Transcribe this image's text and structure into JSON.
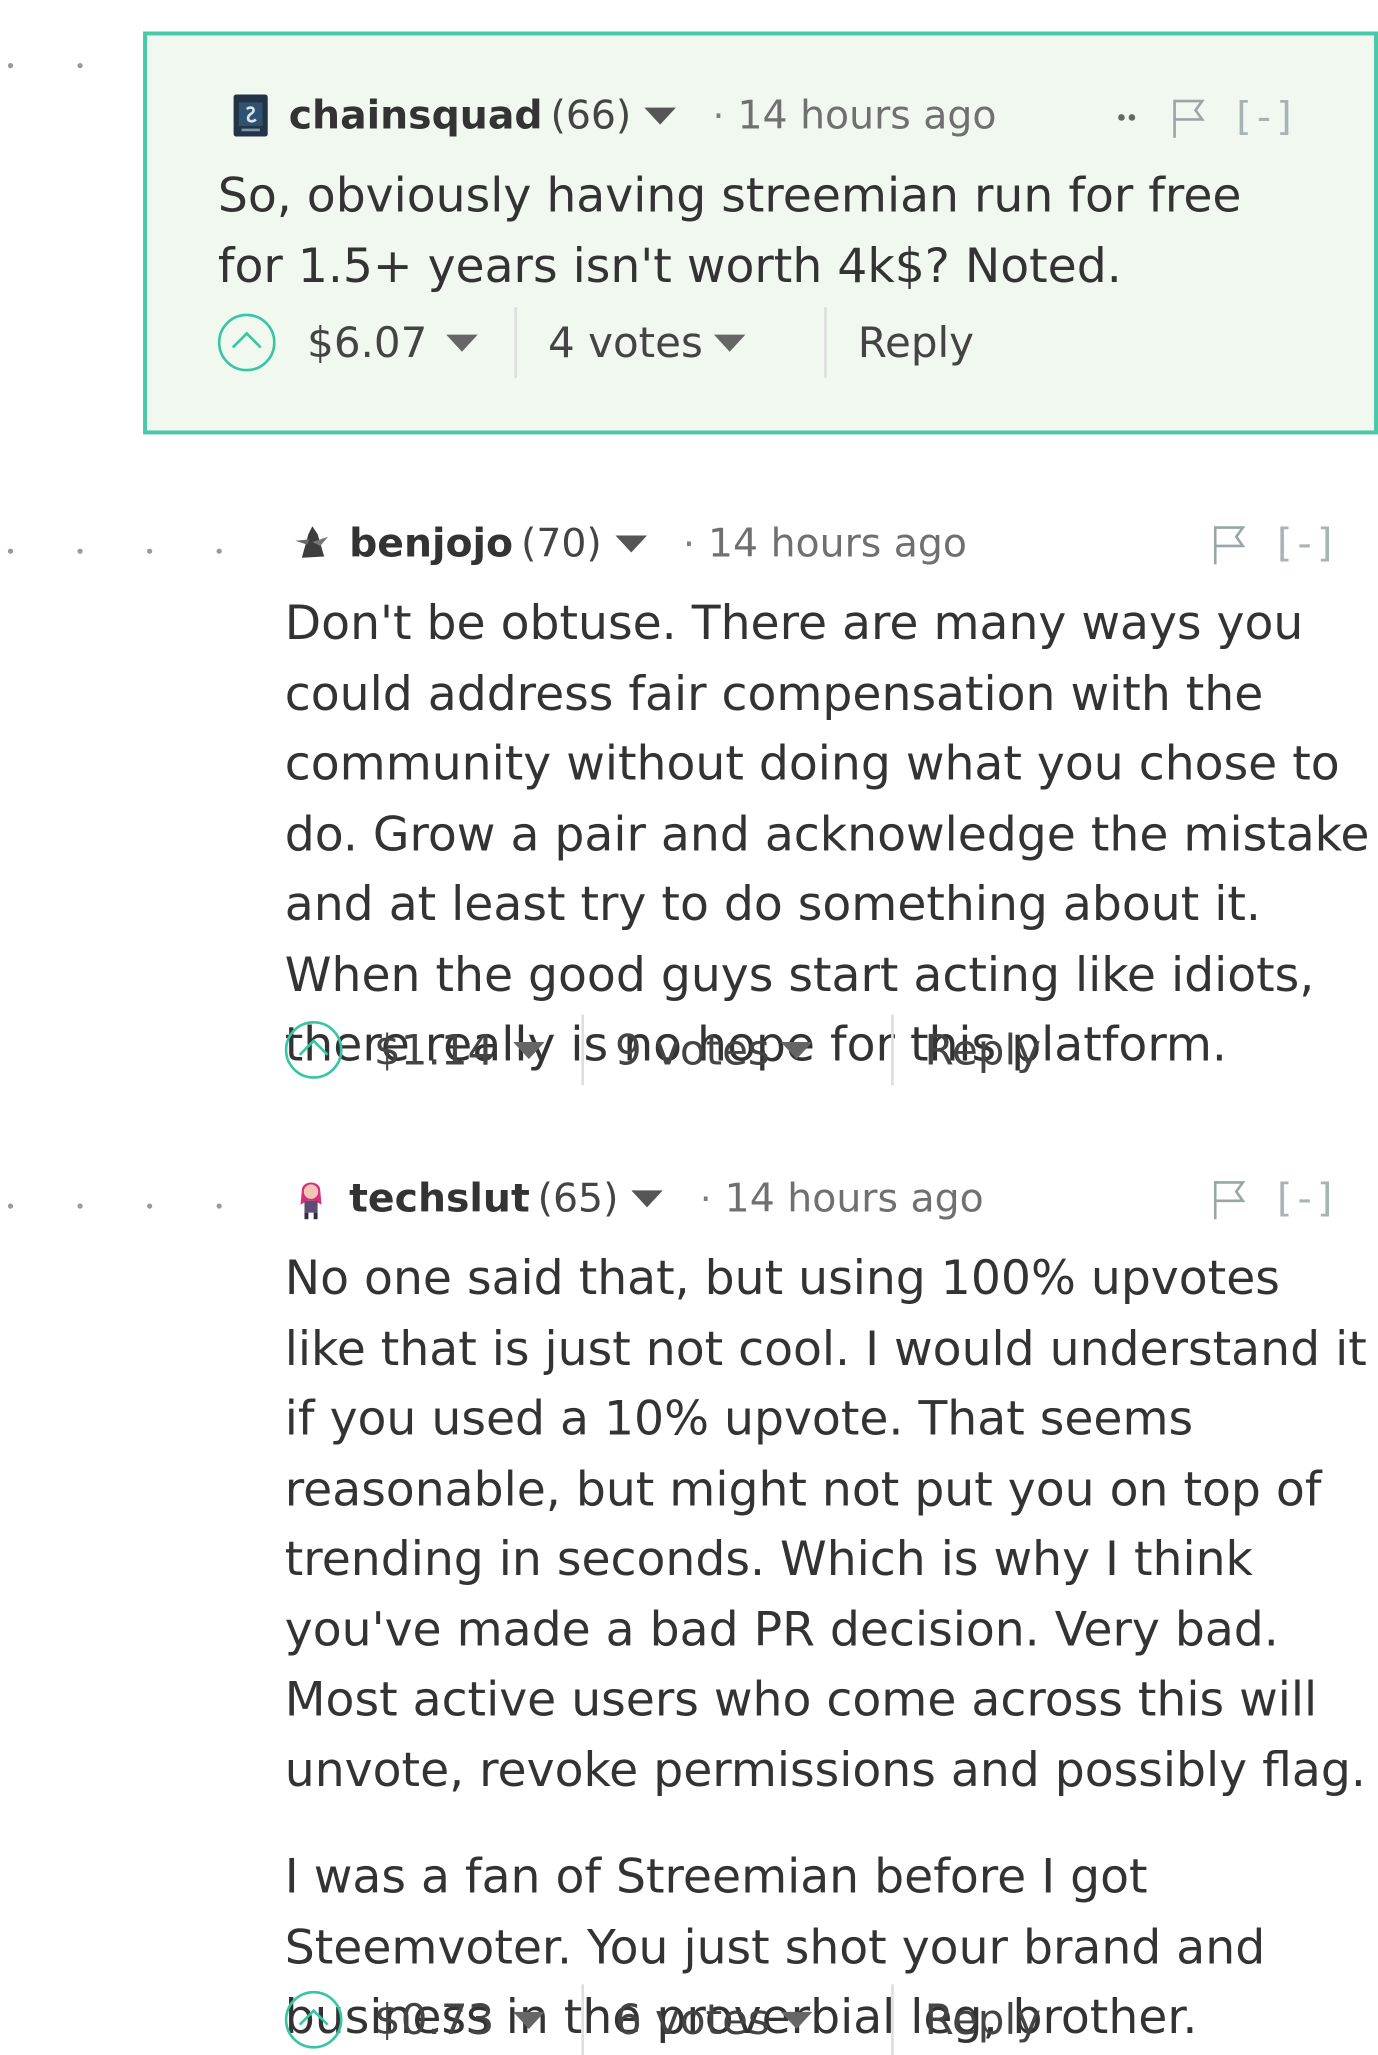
{
  "comments": [
    {
      "author": "chainsquad",
      "reputation": "(66)",
      "time_separator": "·",
      "time": "14 hours ago",
      "body": [
        "So, obviously having streemian run for free for 1.5+ years isn't worth 4k$? Noted."
      ],
      "payout": "$6.07",
      "votes": "4 votes",
      "reply": "Reply",
      "collapse": "[-]",
      "highlighted": true,
      "avatar_icon": "chainsquad-avatar-icon"
    },
    {
      "author": "benjojo",
      "reputation": "(70)",
      "time_separator": "·",
      "time": "14 hours ago",
      "body": [
        "Don't be obtuse. There are many ways you could address fair compensation with the community without doing what you chose to do. Grow a pair and acknowledge the mistake and at least try to do something about it. When the good guys start acting like idiots, there really is no hope for this platform."
      ],
      "payout": "$1.14",
      "votes": "9 votes",
      "reply": "Reply",
      "collapse": "[-]",
      "highlighted": false,
      "avatar_icon": "benjojo-avatar-icon"
    },
    {
      "author": "techslut",
      "reputation": "(65)",
      "time_separator": "·",
      "time": "14 hours ago",
      "body": [
        "No one said that, but using 100% upvotes like that is just not cool. I would understand it if you used a 10% upvote. That seems reasonable, but might not put you on top of trending in seconds. Which is why I think you've made a bad PR decision. Very bad. Most active users who come across this will unvote, revoke permissions and possibly flag.",
        "I was a fan of Streemian before I got Steemvoter. You just shot your brand and business in the proverbial leg, brother."
      ],
      "payout": "$0.73",
      "votes": "6 votes",
      "reply": "Reply",
      "collapse": "[-]",
      "highlighted": false,
      "avatar_icon": "techslut-avatar-icon"
    }
  ],
  "colors": {
    "highlight_border": "#48c9a8",
    "highlight_background": "#f1f8ef",
    "upvote_accent": "#37c6a2",
    "text": "#333333",
    "muted": "#707070"
  }
}
